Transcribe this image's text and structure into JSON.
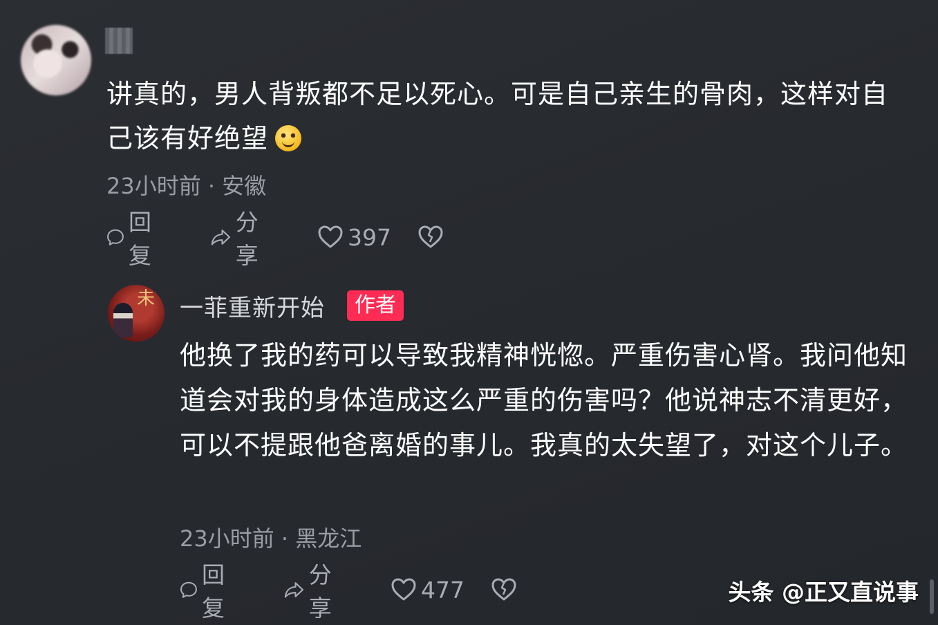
{
  "comments": [
    {
      "username": "",
      "text": "讲真的，男人背叛都不足以死心。可是自己亲生的骨肉，这样对自己该有好绝望",
      "emoji": "smile-emoji",
      "time": "23小时前",
      "separator": "·",
      "location": "安徽",
      "actions": {
        "reply": "回复",
        "share": "分享",
        "likes": "397"
      }
    }
  ],
  "reply": {
    "username": "一菲重新开始",
    "badge": "作者",
    "text": "他换了我的药可以导致我精神恍惚。严重伤害心肾。我问他知道会对我的身体造成这么严重的伤害吗？他说神志不清更好，可以不提跟他爸离婚的事儿。我真的太失望了，对这个儿子。",
    "time": "23小时前",
    "separator": "·",
    "location": "黑龙江",
    "actions": {
      "reply": "回复",
      "share": "分享",
      "likes": "477"
    },
    "avatar_glyph": "未"
  },
  "watermark": "头条 @正又直说事",
  "colors": {
    "background": "#282b30",
    "badge": "#fe2c55",
    "meta": "#9a9da3",
    "action": "#a9acb2"
  },
  "icons": [
    "comment-bubble-icon",
    "share-arrow-icon",
    "heart-icon",
    "broken-heart-icon"
  ]
}
